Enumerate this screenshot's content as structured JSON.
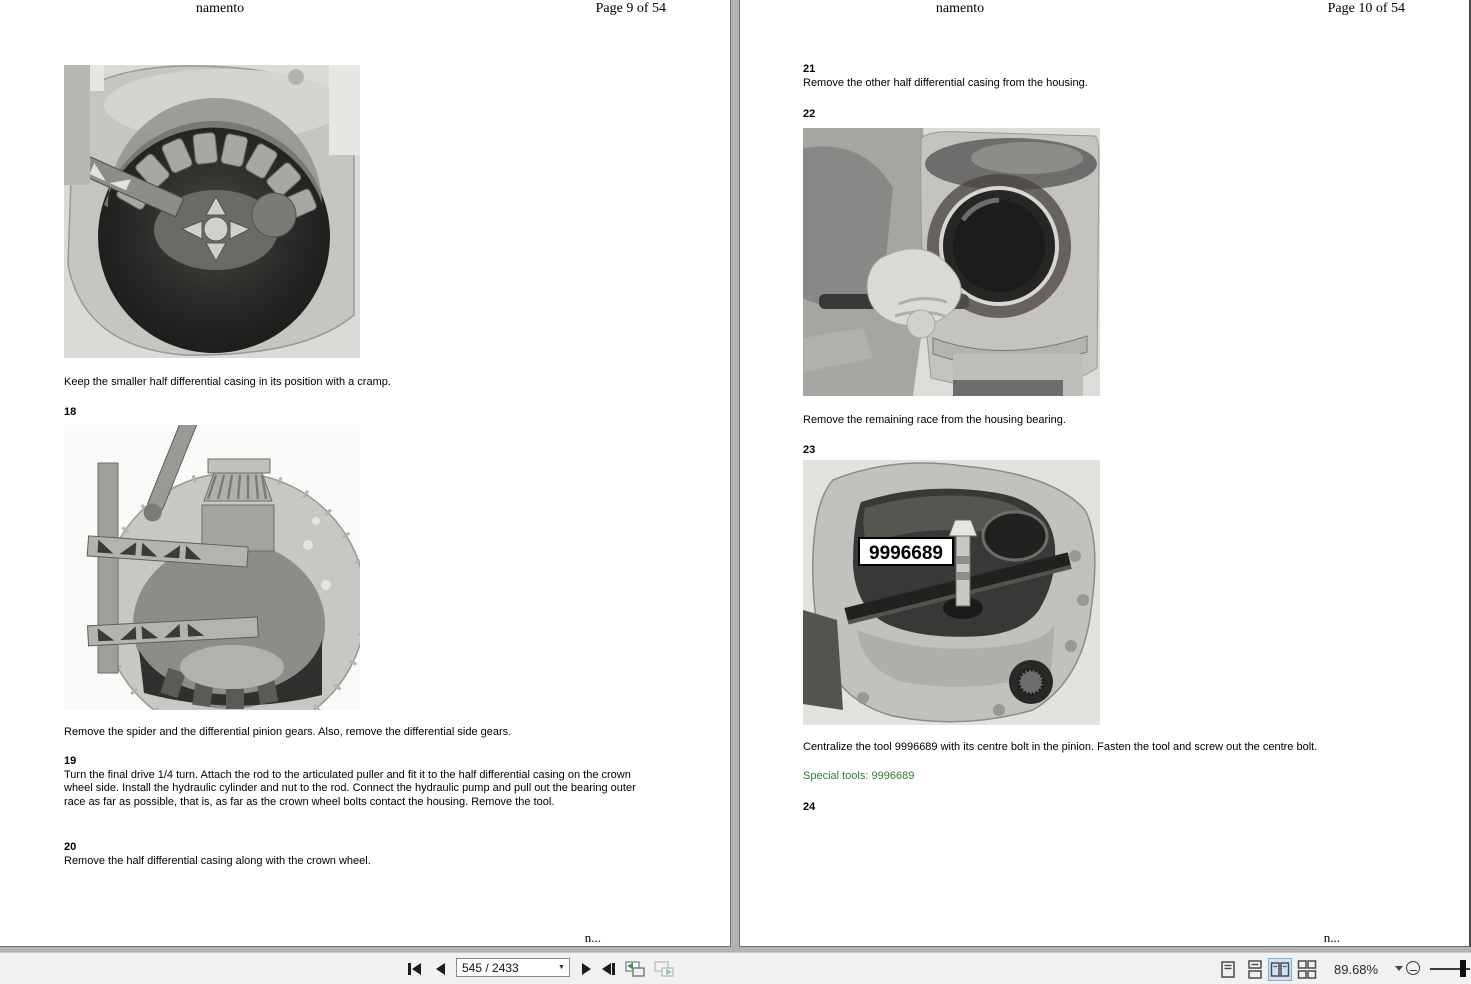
{
  "left_page": {
    "header": {
      "title": "namento",
      "page_label": "Page 9 of 54"
    },
    "caption_fig17": "Keep the smaller half differential casing in its position with a cramp.",
    "step18_num": "18",
    "caption_fig18": "Remove the spider and the differential pinion gears. Also, remove the differential side gears.",
    "step19_num": "19",
    "step19_text": "Turn the final drive 1/4 turn. Attach the rod to the articulated puller and fit it to the half differential casing on the crown wheel side. Install the hydraulic cylinder and nut to the rod. Connect the hydraulic pump and pull out the bearing outer race as far as possible, that is, as far as the crown wheel bolts contact the housing. Remove the tool.",
    "step20_num": "20",
    "step20_text": "Remove the half differential casing along with the crown wheel.",
    "footer": "n..."
  },
  "right_page": {
    "header": {
      "title": "namento",
      "page_label": "Page 10 of 54"
    },
    "step21_num": "21",
    "step21_text": "Remove the other half differential casing from the housing.",
    "step22_num": "22",
    "caption_fig22": "Remove the remaining race from the housing bearing.",
    "step23_num": "23",
    "fig23_label": "9996689",
    "caption_fig23": "Centralize the tool 9996689 with its centre bolt in the pinion. Fasten the tool and screw out the centre bolt.",
    "special_tools": "Special tools: 9996689",
    "step24_num": "24",
    "footer": "n..."
  },
  "toolbar": {
    "page_field": "545 / 2433",
    "zoom_level": "89.68%",
    "icons": {
      "first_page": "first-page",
      "previous_page": "previous-page",
      "page_dropdown": "chevron-down",
      "next_page": "next-page",
      "last_page": "last-page",
      "previous_view": "previous-view",
      "next_view": "next-view",
      "layout_single": "single-page-view",
      "layout_continuous": "continuous-view",
      "layout_facing": "two-page-view",
      "layout_facing_continuous": "two-page-continuous-view",
      "zoom_dropdown": "chevron-down",
      "zoom_out": "minus-circle",
      "zoom_slider": "zoom-slider"
    },
    "active_layout": "two-page-view"
  },
  "colors": {
    "special_tools_green": "#2e7d32",
    "active_layout_bg": "#cfe3f8",
    "active_layout_border": "#7aaede",
    "viewer_background": "#b2b2b2",
    "toolbar_background": "#f1f1f0"
  }
}
